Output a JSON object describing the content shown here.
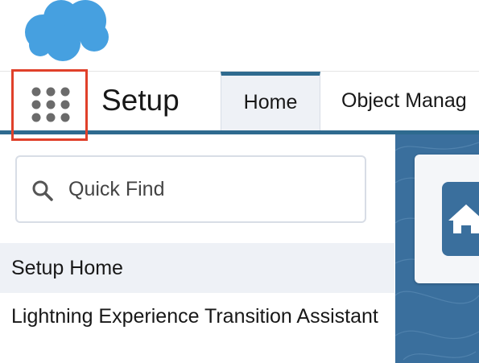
{
  "header": {
    "logo_icon": "salesforce-cloud-logo",
    "app_launcher_icon": "app-launcher-grid-icon",
    "app_name": "Setup",
    "tabs": [
      {
        "label": "Home",
        "active": true
      },
      {
        "label": "Object Manag",
        "active": false
      }
    ]
  },
  "sidebar": {
    "quick_find": {
      "placeholder": "Quick Find",
      "value": "",
      "icon": "search-icon"
    },
    "items": [
      {
        "label": "Setup Home",
        "selected": true
      },
      {
        "label": "Lightning Experience Transition Assistant",
        "selected": false
      }
    ]
  },
  "main": {
    "home_tile_icon": "home-icon"
  },
  "colors": {
    "brand_cloud": "#46a0e0",
    "accent": "#2e6a8f",
    "highlight_box": "#e0402a",
    "selected_bg": "#eef1f6"
  }
}
